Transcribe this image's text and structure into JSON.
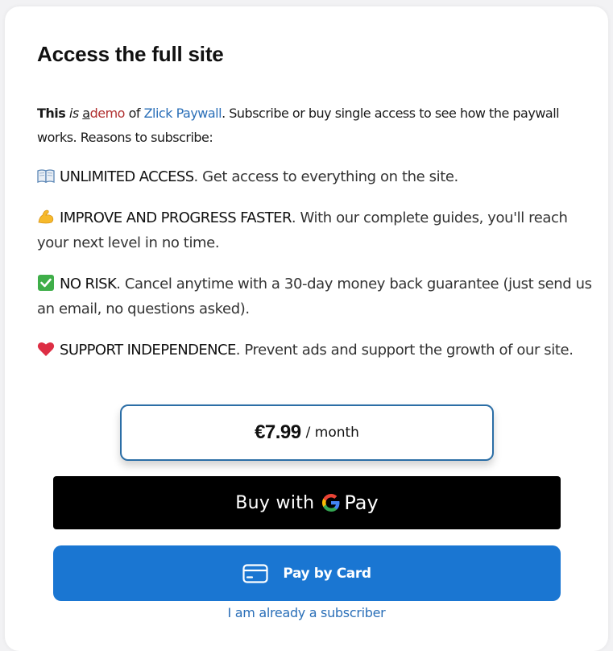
{
  "paywall": {
    "title": "Access the full site",
    "intro": {
      "this": "This",
      "is": "is",
      "a": "a",
      "demo": "demo",
      "of": "of",
      "brand": "Zlick Paywall",
      "rest": ". Subscribe or buy single access to see how the paywall works. Reasons to subscribe:"
    },
    "reasons": [
      {
        "icon": "book-icon",
        "heading": "UNLIMITED ACCESS",
        "text": ". Get access to everything on the site."
      },
      {
        "icon": "flexed-biceps-icon",
        "heading": "IMPROVE AND PROGRESS FASTER",
        "text": ". With our complete guides, you'll reach your next level in no time."
      },
      {
        "icon": "check-mark-icon",
        "heading": "NO RISK",
        "text": ". Cancel anytime with a 30-day money back guarantee (just send us an email, no questions asked)."
      },
      {
        "icon": "heart-icon",
        "heading": "SUPPORT INDEPENDENCE",
        "text": ". Prevent ads and support the growth of our site."
      }
    ],
    "price": {
      "amount": "€7.99",
      "period": "/ month"
    },
    "gpay_button": {
      "buy_label": "Buy with",
      "pay_label": "Pay"
    },
    "card_button": {
      "label": "Pay by Card"
    },
    "subscriber_link": "I am already a subscriber",
    "colors": {
      "accent_blue": "#1a76d2",
      "link_blue": "#2a6fb8",
      "price_border": "#2b6ea6",
      "demo_red": "#b03030",
      "gpay_bg": "#000000"
    }
  }
}
